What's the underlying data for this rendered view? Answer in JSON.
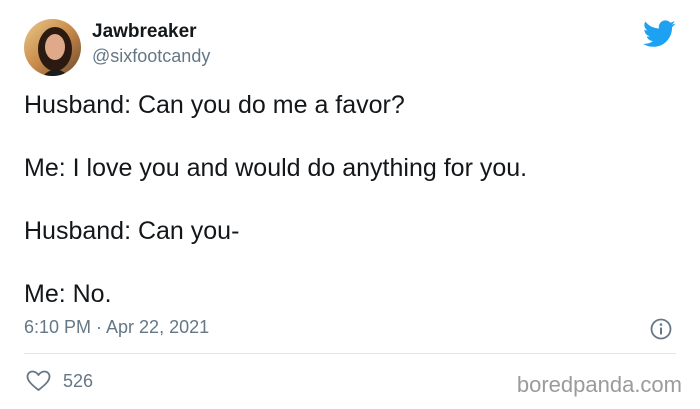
{
  "author": {
    "display_name": "Jawbreaker",
    "handle": "@sixfootcandy"
  },
  "icons": {
    "brand": "twitter-bird-icon",
    "info": "info-icon",
    "like": "heart-icon"
  },
  "colors": {
    "brand_blue": "#1da1f2",
    "secondary_text": "#657786",
    "primary_text": "#14171a",
    "divider": "#e1e8ed"
  },
  "tweet": {
    "lines": [
      "Husband: Can you do me a favor?",
      "Me: I love you and would do anything for you.",
      "Husband: Can you-",
      "Me: No."
    ],
    "timestamp": "6:10 PM · Apr 22, 2021",
    "like_count": "526"
  },
  "watermark": "boredpanda.com"
}
